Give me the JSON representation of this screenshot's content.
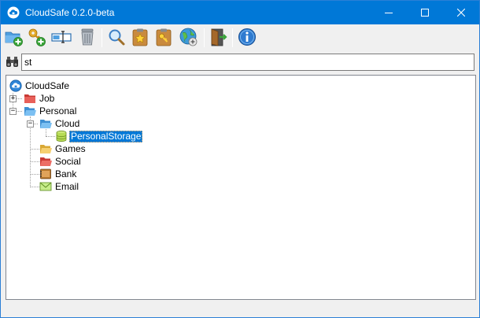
{
  "window": {
    "title": "CloudSafe 0.2.0-beta",
    "app_icon": "cloud-safe-icon"
  },
  "toolbar": {
    "buttons": [
      {
        "name": "new-folder-button",
        "icon": "folder-add-icon"
      },
      {
        "name": "add-key-button",
        "icon": "key-add-icon"
      },
      {
        "name": "rename-button",
        "icon": "rename-field-icon"
      },
      {
        "name": "delete-button",
        "icon": "trash-can-icon"
      },
      {
        "name": "search-button",
        "icon": "magnifier-icon"
      },
      {
        "name": "favorites-button",
        "icon": "star-clipboard-icon"
      },
      {
        "name": "credentials-button",
        "icon": "key-clipboard-icon"
      },
      {
        "name": "sync-button",
        "icon": "globe-sync-icon"
      },
      {
        "name": "exit-button",
        "icon": "door-exit-icon"
      },
      {
        "name": "about-button",
        "icon": "info-icon"
      }
    ]
  },
  "search": {
    "value": "st",
    "icon": "binoculars-icon"
  },
  "tree": {
    "root": "CloudSafe",
    "items": {
      "job": "Job",
      "personal": "Personal",
      "cloud": "Cloud",
      "personal_storage": "PersonalStorage",
      "games": "Games",
      "social": "Social",
      "bank": "Bank",
      "email": "Email"
    },
    "selected": "PersonalStorage"
  },
  "colors": {
    "titlebar": "#0078d7",
    "selection": "#0078d7",
    "folder_blue": "#5aa9e6",
    "folder_red": "#e0504a",
    "folder_yellow": "#f3c85a"
  }
}
